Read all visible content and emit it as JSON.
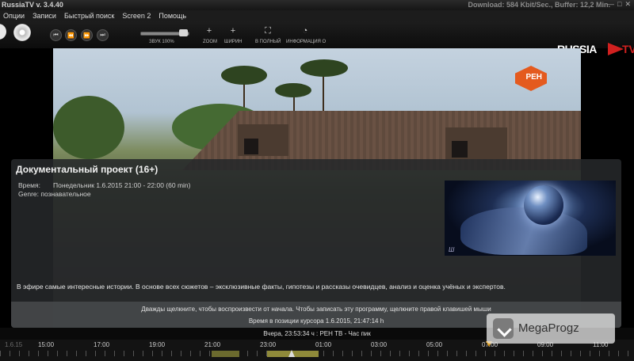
{
  "window": {
    "title": "RussiaTV v. 3.4.40",
    "status": "Download: 584 Kbit/Sec., Buffer: 12,2 Min.",
    "controls": [
      "—",
      "□",
      "✕"
    ]
  },
  "menu": [
    "Опции",
    "Записи",
    "Быстрый поиск",
    "Screen 2",
    "Помощь"
  ],
  "toolbar": {
    "transport": [
      "⏮",
      "⏪",
      "⏩",
      "⏭"
    ],
    "volume_label": "ЗВУК 100%",
    "volume_level": 1.0,
    "buttons": [
      {
        "icon": "plus-icon",
        "glyph": "+",
        "label": "ZOOM"
      },
      {
        "icon": "plus-icon",
        "glyph": "+",
        "label": "ШИРИН"
      },
      {
        "icon": "fullscreen-icon",
        "glyph": "⛶",
        "label": "В ПОЛНЫЙ"
      },
      {
        "icon": "info-icon",
        "glyph": "◔",
        "label": "ИНФОРМАЦИЯ О"
      }
    ]
  },
  "logo": {
    "text": "RUSSIA",
    "accent": "TV",
    "color": "#d0201f"
  },
  "video": {
    "channel_logo": "РЕН"
  },
  "program": {
    "title": "Документальный проект (16+)",
    "time_label": "Время:",
    "time_value": "Понедельник 1.6.2015 21:00 - 22:00 (60 min)",
    "genre": "Genre: познавательное",
    "description": "В эфире самые интересные истории. В основе всех сюжетов – эксклюзивные факты, гипотезы и рассказы очевидцев, анализ и оценка учёных и экспертов.",
    "hint": "Дважды щелкните, чтобы воспроизвести от начала. Чтобы записать эту программу, щелкните правой клавишей мыши",
    "cursor_time": "Время в позиции курсора 1.6.2015, 21:47:14 h"
  },
  "status": "Вчера, 23:53:34 ч : РЕН ТВ - Час пик",
  "timeline": {
    "hours": [
      "1.6.15",
      "15:00",
      "17:00",
      "19:00",
      "21:00",
      "23:00",
      "01:00",
      "03:00",
      "05:00",
      "07:00",
      "09:00",
      "11:00"
    ]
  },
  "watermark": {
    "text": "MegaProgz"
  }
}
